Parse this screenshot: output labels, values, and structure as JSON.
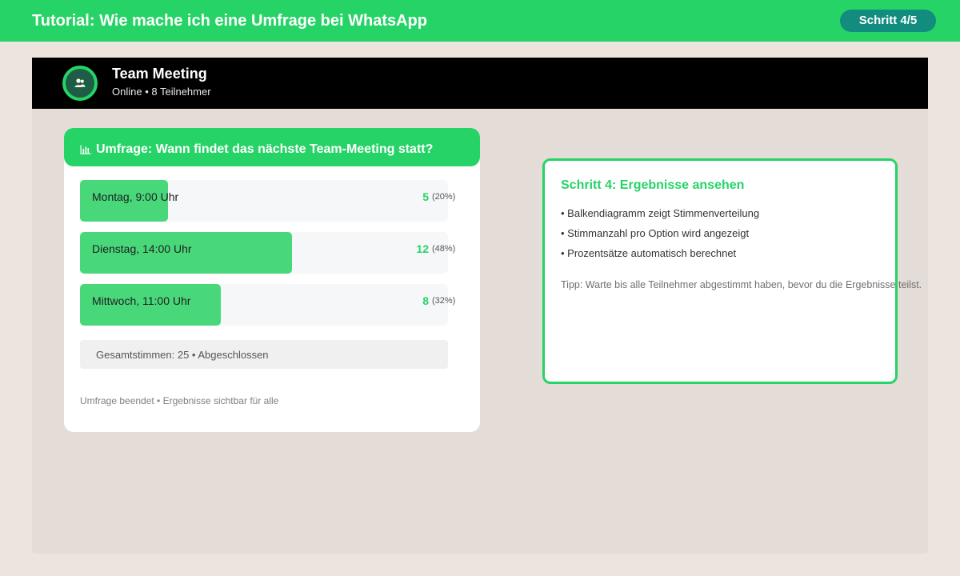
{
  "banner": {
    "title": "Tutorial: Wie mache ich eine Umfrage bei WhatsApp",
    "step_label": "Schritt 4/5"
  },
  "chat": {
    "name": "Team Meeting",
    "status": "Online • 8 Teilnehmer",
    "avatar_icon": "group-icon"
  },
  "poll": {
    "icon": "bar-chart-icon",
    "question": "Umfrage: Wann findet das nächste Team-Meeting statt?",
    "options": [
      {
        "label": "Montag, 9:00 Uhr",
        "votes": "5",
        "percent_label": "(20%)",
        "fraction": 0.2
      },
      {
        "label": "Dienstag, 14:00 Uhr",
        "votes": "12",
        "percent_label": "(48%)",
        "fraction": 0.48
      },
      {
        "label": "Mittwoch, 11:00 Uhr",
        "votes": "8",
        "percent_label": "(32%)",
        "fraction": 0.32
      }
    ],
    "total": "Gesamtstimmen: 25 • Abgeschlossen",
    "footer": "Umfrage beendet • Ergebnisse sichtbar für alle"
  },
  "instructions": {
    "title": "Schritt 4: Ergebnisse ansehen",
    "bullets": [
      "• Balkendiagramm zeigt Stimmenverteilung",
      "• Stimmanzahl pro Option wird angezeigt",
      "• Prozentsätze automatisch berechnet"
    ],
    "tip": "Tipp: Warte bis alle Teilnehmer abgestimmt haben, bevor du die Ergebnisse teilst."
  },
  "colors": {
    "brand_green": "#26d366",
    "dark_teal": "#128c7e",
    "bar_fill": "#48d87a",
    "header_black": "#000000",
    "chat_background": "#e4dcd6"
  }
}
